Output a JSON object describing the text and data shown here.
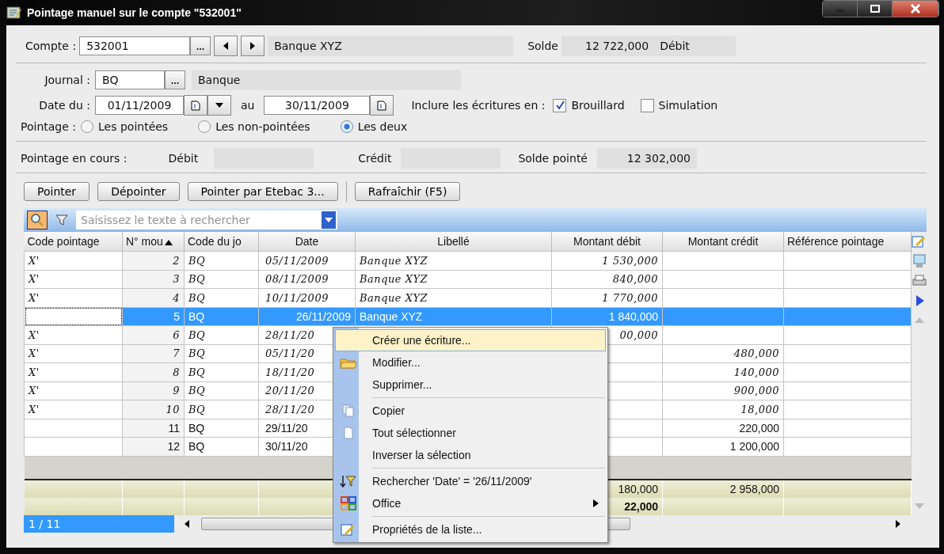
{
  "window": {
    "title": "Pointage manuel sur le compte \"532001\""
  },
  "account": {
    "label": "Compte :",
    "value": "532001",
    "name": "Banque XYZ",
    "balance_label": "Solde",
    "balance": "12 722,000",
    "balance_side": "Débit"
  },
  "journal": {
    "label": "Journal :",
    "value": "BQ",
    "name": "Banque"
  },
  "dates": {
    "label": "Date du :",
    "from": "01/11/2009",
    "between": "au",
    "to": "30/11/2009"
  },
  "include": {
    "label": "Inclure les écritures en :",
    "options": [
      {
        "label": "Brouillard",
        "checked": true
      },
      {
        "label": "Simulation",
        "checked": false
      }
    ]
  },
  "pointage": {
    "label": "Pointage :",
    "options": [
      {
        "label": "Les pointées",
        "selected": false
      },
      {
        "label": "Les non-pointées",
        "selected": false
      },
      {
        "label": "Les deux",
        "selected": true
      }
    ]
  },
  "current": {
    "label": "Pointage en cours :",
    "debit_label": "Débit",
    "credit_label": "Crédit",
    "solde_label": "Solde pointé",
    "solde": "12 302,000"
  },
  "button_groups": [
    [
      "Pointer",
      "Dépointer",
      "Pointer par Etebac 3..."
    ],
    [
      "Rafraîchir (F5)"
    ]
  ],
  "search": {
    "placeholder": "Saisissez le texte à rechercher"
  },
  "table": {
    "columns": [
      {
        "label": "Code pointage",
        "sorted": false
      },
      {
        "label": "N° mou",
        "sorted": true
      },
      {
        "label": "Code du jo",
        "sorted": false
      },
      {
        "label": "Date",
        "sorted": false
      },
      {
        "label": "Libellé",
        "sorted": false
      },
      {
        "label": "Montant débit",
        "sorted": false
      },
      {
        "label": "Montant crédit",
        "sorted": false
      },
      {
        "label": "Référence pointage",
        "sorted": false
      }
    ],
    "rows": [
      {
        "pointed": true,
        "selected": false,
        "cells": [
          "X'",
          "2",
          "BQ",
          "05/11/2009",
          "Banque XYZ",
          "1 530,000",
          "",
          ""
        ]
      },
      {
        "pointed": true,
        "selected": false,
        "cells": [
          "X'",
          "3",
          "BQ",
          "08/11/2009",
          "Banque XYZ",
          "840,000",
          "",
          ""
        ]
      },
      {
        "pointed": true,
        "selected": false,
        "cells": [
          "X'",
          "4",
          "BQ",
          "10/11/2009",
          "Banque XYZ",
          "1 770,000",
          "",
          ""
        ]
      },
      {
        "pointed": false,
        "selected": true,
        "cells": [
          "",
          "5",
          "BQ",
          "26/11/2009",
          "Banque XYZ",
          "1 840,000",
          "",
          ""
        ]
      },
      {
        "pointed": true,
        "selected": false,
        "cells": [
          "X'",
          "6",
          "BQ",
          "28/11/20",
          "",
          "00,000",
          "",
          ""
        ]
      },
      {
        "pointed": true,
        "selected": false,
        "cells": [
          "X'",
          "7",
          "BQ",
          "05/11/20",
          "",
          "",
          "480,000",
          ""
        ]
      },
      {
        "pointed": true,
        "selected": false,
        "cells": [
          "X'",
          "8",
          "BQ",
          "18/11/20",
          "",
          "",
          "140,000",
          ""
        ]
      },
      {
        "pointed": true,
        "selected": false,
        "cells": [
          "X'",
          "9",
          "BQ",
          "20/11/20",
          "",
          "",
          "900,000",
          ""
        ]
      },
      {
        "pointed": true,
        "selected": false,
        "cells": [
          "X'",
          "10",
          "BQ",
          "28/11/20",
          "",
          "",
          "18,000",
          ""
        ]
      },
      {
        "pointed": false,
        "selected": false,
        "cells": [
          "",
          "11",
          "BQ",
          "29/11/20",
          "",
          "",
          "220,000",
          ""
        ]
      },
      {
        "pointed": false,
        "selected": false,
        "cells": [
          "",
          "12",
          "BQ",
          "30/11/20",
          "",
          "",
          "1 200,000",
          ""
        ]
      }
    ],
    "totals": [
      {
        "bold": false,
        "debit": "180,000",
        "credit": "2 958,000"
      },
      {
        "bold": true,
        "debit": "22,000"
      }
    ]
  },
  "status": {
    "position": "1 / 11"
  },
  "context_menu": {
    "items": [
      {
        "label": "Créer une écriture...",
        "selected": true,
        "separator_before": false,
        "submenu": false
      },
      {
        "label": "Modifier...",
        "selected": false,
        "separator_before": false,
        "submenu": false
      },
      {
        "label": "Supprimer...",
        "selected": false,
        "separator_before": false,
        "submenu": false
      },
      {
        "label": "Copier",
        "selected": false,
        "separator_before": true,
        "submenu": false
      },
      {
        "label": "Tout sélectionner",
        "selected": false,
        "separator_before": false,
        "submenu": false
      },
      {
        "label": "Inverser la sélection",
        "selected": false,
        "separator_before": false,
        "submenu": false
      },
      {
        "label": "Rechercher 'Date' = '26/11/2009'",
        "selected": false,
        "separator_before": true,
        "submenu": false
      },
      {
        "label": "Office",
        "selected": false,
        "separator_before": false,
        "submenu": true
      },
      {
        "label": "Propriétés de la liste...",
        "selected": false,
        "separator_before": true,
        "submenu": false
      }
    ]
  }
}
